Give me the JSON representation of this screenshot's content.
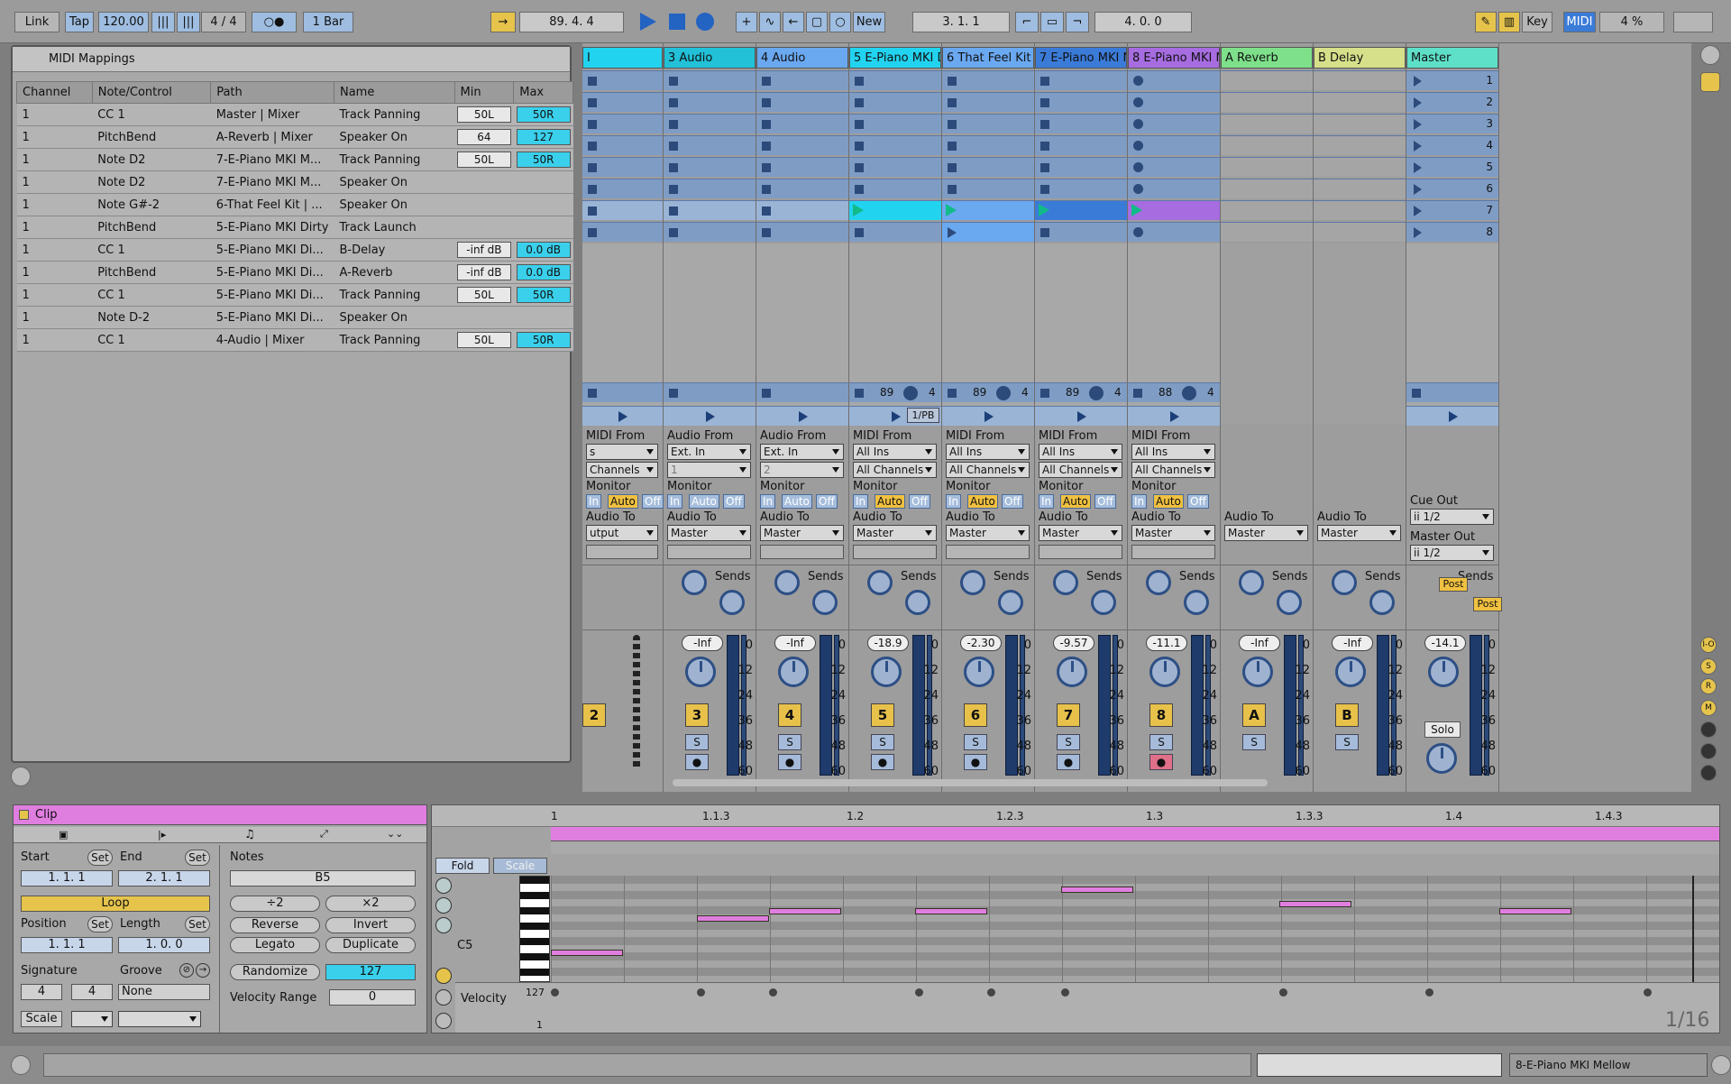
{
  "toolbar": {
    "link": "Link",
    "tap": "Tap",
    "tempo": "120.00",
    "signature": "4 / 4",
    "quantize": "1 Bar",
    "arrangement_position": "89.  4.  4",
    "new": "New",
    "loop_start": "3.  1.  1",
    "loop_length": "4.  0.  0",
    "key": "Key",
    "midi": "MIDI",
    "cpu": "4 %"
  },
  "midi_mappings": {
    "title": "MIDI Mappings",
    "columns": [
      "Channel",
      "Note/Control",
      "Path",
      "Name",
      "Min",
      "Max"
    ],
    "rows": [
      {
        "channel": "1",
        "control": "CC 1",
        "path": "Master | Mixer",
        "name": "Track Panning",
        "min": "50L",
        "max": "50R"
      },
      {
        "channel": "1",
        "control": "PitchBend",
        "path": "A-Reverb | Mixer",
        "name": "Speaker On",
        "min": "64",
        "max": "127"
      },
      {
        "channel": "1",
        "control": "Note D2",
        "path": "7-E-Piano MKI M...",
        "name": "Track Panning",
        "min": "50L",
        "max": "50R"
      },
      {
        "channel": "1",
        "control": "Note D2",
        "path": "7-E-Piano MKI M...",
        "name": "Speaker On",
        "min": "",
        "max": ""
      },
      {
        "channel": "1",
        "control": "Note G#-2",
        "path": "6-That Feel Kit | ...",
        "name": "Speaker On",
        "min": "",
        "max": ""
      },
      {
        "channel": "1",
        "control": "PitchBend",
        "path": "5-E-Piano MKI Dirty",
        "name": "Track Launch",
        "min": "",
        "max": ""
      },
      {
        "channel": "1",
        "control": "CC 1",
        "path": "5-E-Piano MKI Di...",
        "name": "B-Delay",
        "min": "-inf dB",
        "max": "0.0 dB"
      },
      {
        "channel": "1",
        "control": "PitchBend",
        "path": "5-E-Piano MKI Di...",
        "name": "A-Reverb",
        "min": "-inf dB",
        "max": "0.0 dB"
      },
      {
        "channel": "1",
        "control": "CC 1",
        "path": "5-E-Piano MKI Di...",
        "name": "Track Panning",
        "min": "50L",
        "max": "50R"
      },
      {
        "channel": "1",
        "control": "Note D-2",
        "path": "5-E-Piano MKI Di...",
        "name": "Speaker On",
        "min": "",
        "max": ""
      },
      {
        "channel": "1",
        "control": "CC 1",
        "path": "4-Audio | Mixer",
        "name": "Track Panning",
        "min": "50L",
        "max": "50R"
      }
    ]
  },
  "tracks": [
    {
      "name": "I",
      "color": "#22d3f0",
      "type": "midi",
      "vol": "",
      "num": "2",
      "from": "From",
      "from_val": "s",
      "chan": "Channels",
      "to": "utput"
    },
    {
      "name": "3 Audio",
      "color": "#22c1d8",
      "type": "audio",
      "vol": "-Inf",
      "num": "3",
      "from_val": "Ext. In",
      "chan": "1",
      "to": "Master"
    },
    {
      "name": "4 Audio",
      "color": "#6aa8f0",
      "type": "audio",
      "vol": "-Inf",
      "num": "4",
      "from_val": "Ext. In",
      "chan": "2",
      "to": "Master"
    },
    {
      "name": "5 E-Piano MKI Dir",
      "color": "#22d3f0",
      "type": "midi",
      "vol": "-18.9",
      "num": "5",
      "from_val": "All Ins",
      "chan": "All Channels",
      "to": "Master"
    },
    {
      "name": "6 That Feel Kit",
      "color": "#6aa8f0",
      "type": "midi",
      "vol": "-2.30",
      "num": "6",
      "from_val": "All Ins",
      "chan": "All Channels",
      "to": "Master"
    },
    {
      "name": "7 E-Piano MKI Mel",
      "color": "#3b7bd8",
      "type": "midi",
      "vol": "-9.57",
      "num": "7",
      "from_val": "All Ins",
      "chan": "All Channels",
      "to": "Master"
    },
    {
      "name": "8 E-Piano MKI Mel",
      "color": "#a66ce0",
      "type": "midi",
      "vol": "-11.1",
      "num": "8",
      "from_val": "All Ins",
      "chan": "All Channels",
      "to": "Master"
    },
    {
      "name": "A Reverb",
      "color": "#7ee08a",
      "type": "return",
      "vol": "-Inf",
      "num": "A"
    },
    {
      "name": "B Delay",
      "color": "#d6e08a",
      "type": "return",
      "vol": "-Inf",
      "num": "B"
    },
    {
      "name": "Master",
      "color": "#5ee0c8",
      "type": "master",
      "vol": "-14.1",
      "num": ""
    }
  ],
  "io_labels": {
    "audio_from": "Audio From",
    "midi_from": "MIDI From",
    "monitor": "Monitor",
    "in": "In",
    "auto": "Auto",
    "off": "Off",
    "audio_to": "Audio To",
    "cue_out": "Cue Out",
    "cue_val": "ii 1/2",
    "master_out": "Master Out",
    "master_val": "ii 1/2",
    "sends": "Sends",
    "post": "Post",
    "solo": "Solo",
    "s": "S"
  },
  "scenes": [
    "1",
    "2",
    "3",
    "4",
    "5",
    "6",
    "7",
    "8"
  ],
  "tempo_readouts": [
    {
      "t": "89",
      "n": "4"
    },
    {
      "t": "89",
      "n": "4"
    },
    {
      "t": "89",
      "n": "4"
    },
    {
      "t": "88",
      "n": "4"
    }
  ],
  "pb": "1/PB",
  "meter_scale": [
    "0",
    "12",
    "24",
    "36",
    "48",
    "60"
  ],
  "clip": {
    "title": "Clip",
    "start_label": "Start",
    "end_label": "End",
    "set": "Set",
    "start": "1.   1.   1",
    "end": "2.   1.   1",
    "loop": "Loop",
    "position_label": "Position",
    "length_label": "Length",
    "position": "1.   1.   1",
    "length": "1.   0.   0",
    "signature_label": "Signature",
    "groove_label": "Groove",
    "sig_num": "4",
    "sig_den": "4",
    "groove": "None",
    "scale": "Scale",
    "notes_label": "Notes",
    "note_value": "B5",
    "div2": "÷2",
    "mul2": "×2",
    "reverse": "Reverse",
    "invert": "Invert",
    "legato": "Legato",
    "duplicate": "Duplicate",
    "randomize": "Randomize",
    "random_value": "127",
    "velocity_range_label": "Velocity Range",
    "velocity_range": "0"
  },
  "editor": {
    "fold": "Fold",
    "scale": "Scale",
    "ruler": [
      "1",
      "1.1.3",
      "1.2",
      "1.2.3",
      "1.3",
      "1.3.3",
      "1.4",
      "1.4.3"
    ],
    "c5": "C5",
    "velocity": "Velocity",
    "vel_max": "127",
    "vel_min": "1",
    "grid": "1/16"
  },
  "statusbar": {
    "track": "8-E-Piano MKI Mellow"
  }
}
